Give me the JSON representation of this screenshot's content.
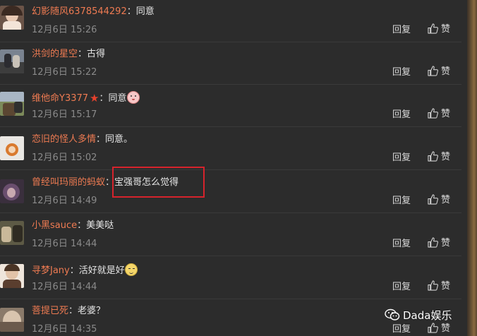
{
  "comments": [
    {
      "username": "幻影随风6378544292",
      "colon": "：",
      "text": "同意",
      "time": "12月6日 15:26",
      "reply": "回复",
      "like": "赞",
      "emoji": ""
    },
    {
      "username": "洪剑的星空",
      "colon": "：",
      "text": "古得",
      "time": "12月6日 15:22",
      "reply": "回复",
      "like": "赞",
      "emoji": ""
    },
    {
      "username": "维他命Y3377",
      "colon": "：",
      "text": "同意",
      "time": "12月6日 15:17",
      "reply": "回复",
      "like": "赞",
      "emoji": "girl-emoji",
      "badge": "star-icon"
    },
    {
      "username": "恋旧的怪人多情",
      "colon": "：",
      "text": "同意。",
      "time": "12月6日 15:02",
      "reply": "回复",
      "like": "赞",
      "emoji": ""
    },
    {
      "username": "曾经叫玛丽的蚂蚁",
      "colon": "：",
      "text": "宝强哥怎么觉得",
      "time": "12月6日 14:49",
      "reply": "回复",
      "like": "赞",
      "emoji": ""
    },
    {
      "username": "小黑sauce",
      "colon": "：",
      "text": "美美哒",
      "time": "12月6日 14:44",
      "reply": "回复",
      "like": "赞",
      "emoji": ""
    },
    {
      "username": "寻梦Jany",
      "colon": "：",
      "text": "活好就是好",
      "time": "12月6日 14:44",
      "reply": "回复",
      "like": "赞",
      "emoji": "cat-emoji"
    },
    {
      "username": "菩提已死",
      "colon": "：",
      "text": "老婆？",
      "time": "12月6日 14:35",
      "reply": "回复",
      "like": "赞",
      "emoji": ""
    }
  ],
  "watermark": {
    "text": "Dada娱乐",
    "icon": "wechat-icon"
  },
  "colors": {
    "background": "#2c2c2c",
    "username": "#ef7b52",
    "timestamp": "#8a8a8a",
    "highlight": "#d6232c"
  }
}
